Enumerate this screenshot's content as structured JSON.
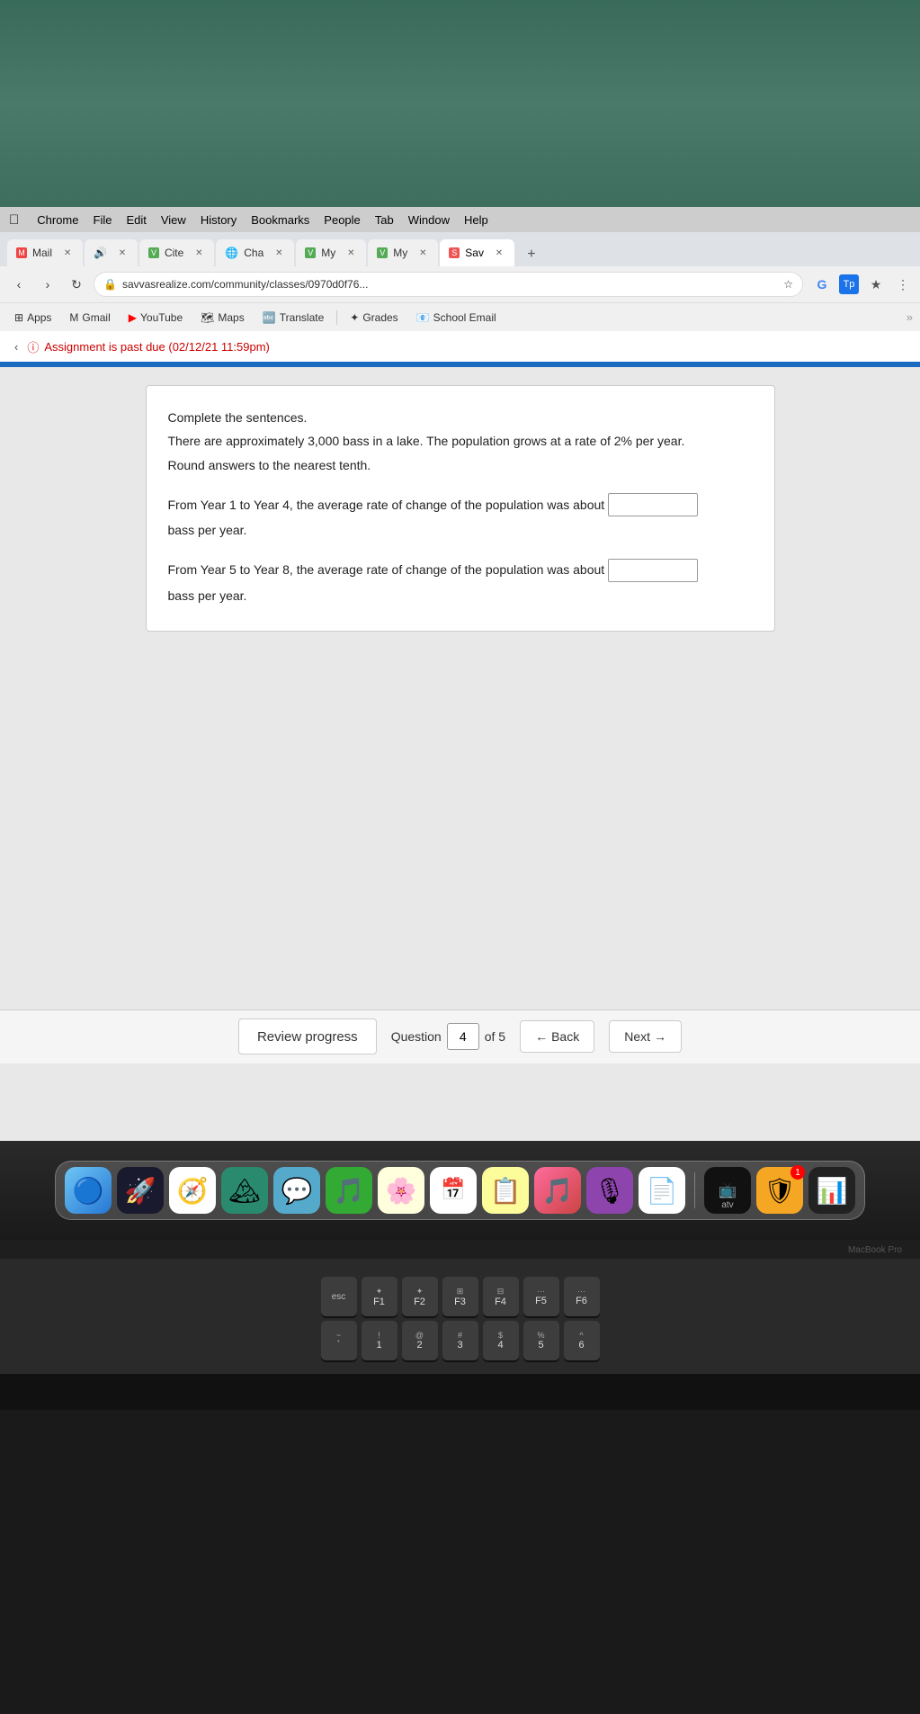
{
  "desktop": {
    "background_color": "#3d6e5e"
  },
  "menubar": {
    "apple_label": "",
    "items": [
      "Chrome",
      "File",
      "Edit",
      "View",
      "History",
      "Bookmarks",
      "People",
      "Tab",
      "Window",
      "Help"
    ]
  },
  "tabs": [
    {
      "id": "tab-mail",
      "label": "Mail",
      "icon": "✉",
      "active": false
    },
    {
      "id": "tab-speaker",
      "label": "",
      "icon": "🔊",
      "active": false
    },
    {
      "id": "tab-cite",
      "label": "Cite",
      "icon": "V",
      "active": false
    },
    {
      "id": "tab-cha",
      "label": "Cha",
      "icon": "🌐",
      "active": false
    },
    {
      "id": "tab-my1",
      "label": "My",
      "icon": "V",
      "active": false
    },
    {
      "id": "tab-my2",
      "label": "My",
      "icon": "V",
      "active": false
    },
    {
      "id": "tab-sav",
      "label": "Sav",
      "icon": "S",
      "active": true
    }
  ],
  "addressbar": {
    "url": "savvasrealize.com/community/classes/0970d0f76...",
    "lock_icon": "🔒",
    "star_icon": "☆"
  },
  "bookmarks": [
    {
      "label": "Apps",
      "icon": "⊞"
    },
    {
      "label": "Gmail",
      "icon": "✉"
    },
    {
      "label": "YouTube",
      "icon": "▶"
    },
    {
      "label": "Maps",
      "icon": "📍"
    },
    {
      "label": "Translate",
      "icon": "🔤"
    },
    {
      "label": "Grades",
      "icon": "✦"
    },
    {
      "label": "School Email",
      "icon": "📧"
    }
  ],
  "assignment_notice": {
    "icon": "ⓘ",
    "text": "Assignment is past due (02/12/21 11:59pm)"
  },
  "question": {
    "instruction": "Complete the sentences.",
    "context_line1": "There are approximately 3,000 bass in a lake. The population grows at a rate of 2% per year.",
    "context_line2": "Round answers to the nearest tenth.",
    "sentence1_prefix": "From Year 1 to Year 4, the average rate of change of the population was about",
    "sentence1_suffix": "bass per year.",
    "sentence2_prefix": "From Year 5 to Year 8, the average rate of change of the population was about",
    "sentence2_suffix": "bass per year."
  },
  "bottom_nav": {
    "review_progress_label": "Review progress",
    "question_label": "Question",
    "question_num": "4",
    "of_label": "of 5",
    "back_label": "← Back",
    "next_label": "Next →"
  },
  "dock": {
    "icons": [
      {
        "name": "finder",
        "emoji": "🔵",
        "label": "Finder"
      },
      {
        "name": "launchpad",
        "emoji": "🚀",
        "label": "Launchpad"
      },
      {
        "name": "safari",
        "emoji": "🧭",
        "label": "Safari"
      },
      {
        "name": "photos-app",
        "emoji": "🏔",
        "label": "Photos"
      },
      {
        "name": "messages",
        "emoji": "💬",
        "label": "Messages"
      },
      {
        "name": "music-flower",
        "emoji": "🎵",
        "label": "Music Note"
      },
      {
        "name": "photos",
        "emoji": "🌸",
        "label": "Photos"
      },
      {
        "name": "notes",
        "emoji": "📝",
        "label": "Notes"
      },
      {
        "name": "music",
        "emoji": "🎵",
        "label": "Music"
      },
      {
        "name": "podcasts",
        "emoji": "🎙",
        "label": "Podcasts"
      },
      {
        "name": "files",
        "emoji": "📄",
        "label": "Files"
      },
      {
        "name": "appletv",
        "emoji": "📺",
        "label": "Apple TV"
      },
      {
        "name": "norton",
        "emoji": "🛡",
        "label": "Norton"
      },
      {
        "name": "stocks",
        "emoji": "📊",
        "label": "Stocks"
      }
    ]
  },
  "keyboard": {
    "fn_row": [
      {
        "top": "",
        "bottom": "esc",
        "wide": false
      },
      {
        "top": "✦",
        "bottom": "F1",
        "wide": false
      },
      {
        "top": "✦",
        "bottom": "F2",
        "wide": false
      },
      {
        "top": "⊞",
        "bottom": "F3",
        "wide": false
      },
      {
        "top": "⊟",
        "bottom": "F4",
        "wide": false
      },
      {
        "top": "...",
        "bottom": "F5",
        "wide": false
      },
      {
        "top": "...",
        "bottom": "F6",
        "wide": false
      }
    ],
    "num_row": [
      {
        "top": "~",
        "bottom": "`",
        "wide": false
      },
      {
        "top": "!",
        "bottom": "1",
        "wide": false
      },
      {
        "top": "@",
        "bottom": "2",
        "wide": false
      },
      {
        "top": "#",
        "bottom": "3",
        "wide": false
      },
      {
        "top": "$",
        "bottom": "4",
        "wide": false
      },
      {
        "top": "%",
        "bottom": "5",
        "wide": false
      },
      {
        "top": "^",
        "bottom": "6",
        "wide": false
      }
    ]
  },
  "macbook_label": "MacBook Pro"
}
